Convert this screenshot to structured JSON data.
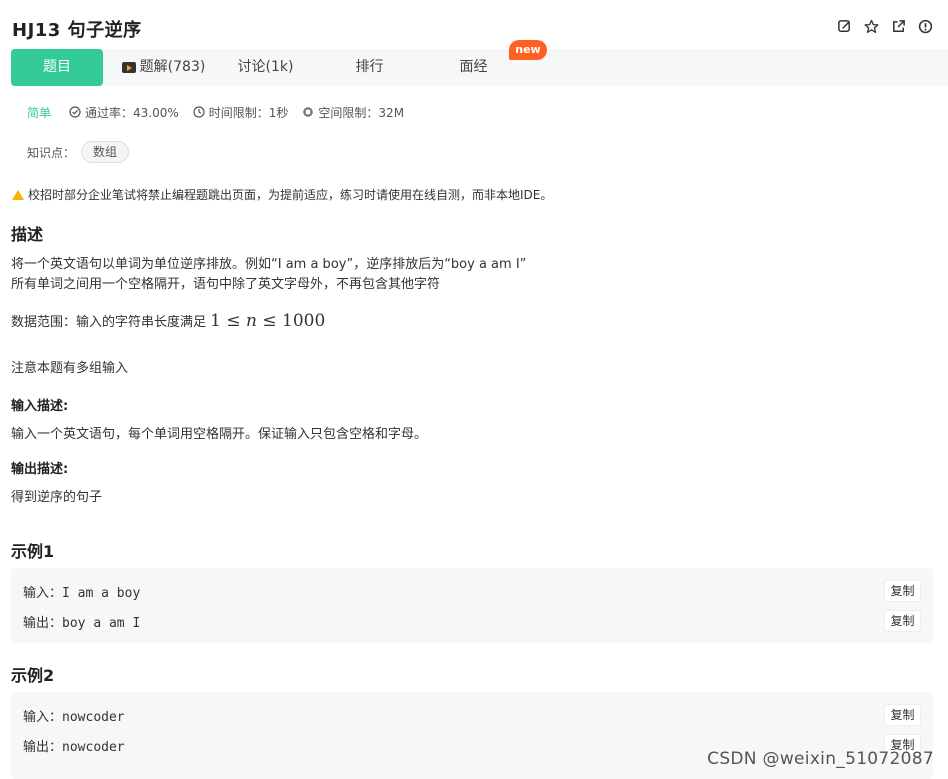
{
  "problem": {
    "title": "HJ13  句子逆序"
  },
  "tabs": {
    "problem": "题目",
    "solutions": "题解(783)",
    "discussion": "讨论(1k)",
    "ranking": "排行",
    "interview": "面经",
    "new_badge": "new"
  },
  "meta": {
    "difficulty": "简单",
    "pass_rate": "通过率：43.00%",
    "time_limit": "时间限制：1秒",
    "space_limit": "空间限制：32M"
  },
  "knowledge": {
    "label": "知识点：",
    "tag": "数组"
  },
  "notice": "校招时部分企业笔试将禁止编程题跳出页面，为提前适应，练习时请使用在线自测，而非本地IDE。",
  "description": {
    "heading": "描述",
    "line1": "将一个英文语句以单词为单位逆序排放。例如“I am a boy”，逆序排放后为“boy a am I”",
    "line2": "所有单词之间用一个空格隔开，语句中除了英文字母外，不再包含其他字符",
    "range_label": "数据范围：输入的字符串长度满足 ",
    "range_math_low": "1",
    "range_math_var": "n",
    "range_math_high": "1000",
    "note": "注意本题有多组输入"
  },
  "input_desc": {
    "heading": "输入描述:",
    "text": "输入一个英文语句，每个单词用空格隔开。保证输入只包含空格和字母。"
  },
  "output_desc": {
    "heading": "输出描述:",
    "text": "得到逆序的句子"
  },
  "examples": [
    {
      "heading": "示例1",
      "input_label": "输入：",
      "input": "I am a boy",
      "output_label": "输出：",
      "output": "boy a am I",
      "copy": "复制"
    },
    {
      "heading": "示例2",
      "input_label": "输入：",
      "input": "nowcoder",
      "output_label": "输出：",
      "output": "nowcoder",
      "copy": "复制"
    }
  ],
  "watermark": "CSDN @weixin_51072087"
}
